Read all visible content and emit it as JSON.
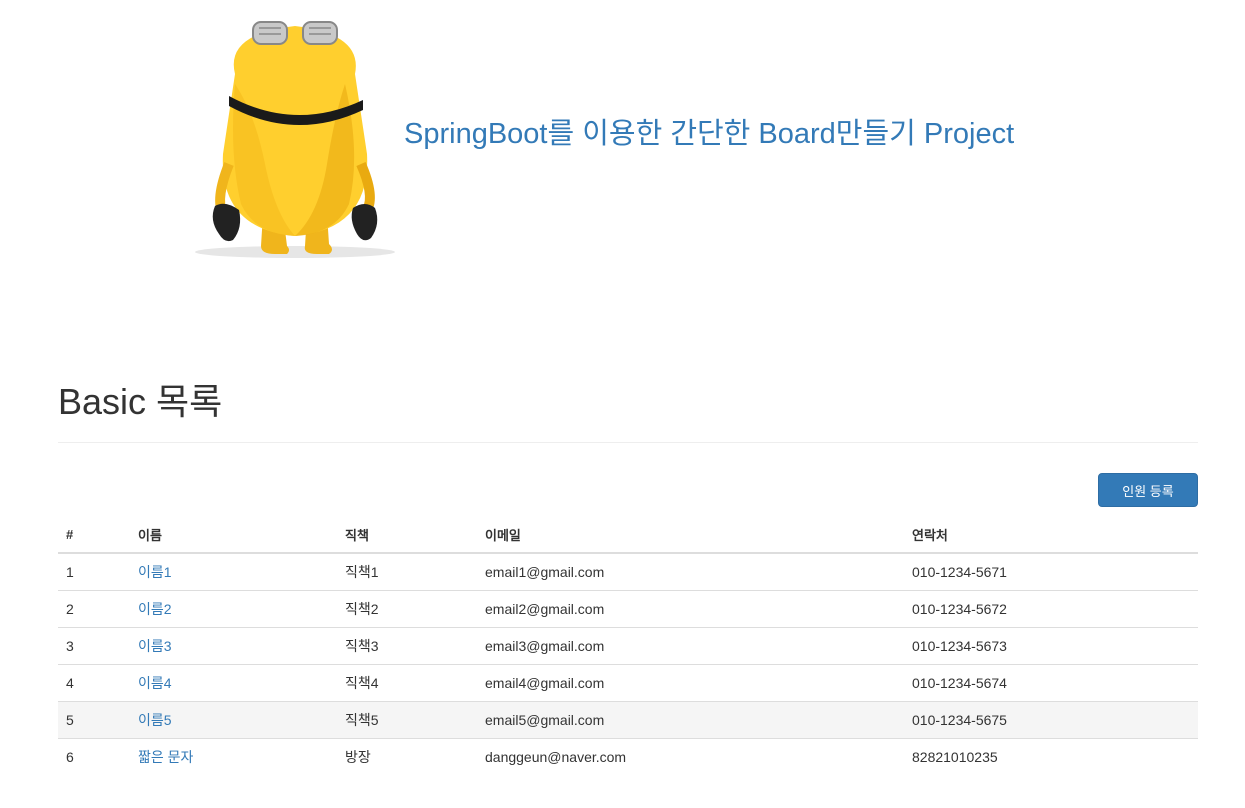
{
  "header": {
    "title": "SpringBoot를 이용한 간단한 Board만들기 Project"
  },
  "page": {
    "title": "Basic 목록",
    "register_button": "인원 등록"
  },
  "table": {
    "columns": [
      "#",
      "이름",
      "직책",
      "이메일",
      "연락처"
    ],
    "rows": [
      {
        "no": "1",
        "name": "이름1",
        "position": "직책1",
        "email": "email1@gmail.com",
        "phone": "010-1234-5671"
      },
      {
        "no": "2",
        "name": "이름2",
        "position": "직책2",
        "email": "email2@gmail.com",
        "phone": "010-1234-5672"
      },
      {
        "no": "3",
        "name": "이름3",
        "position": "직책3",
        "email": "email3@gmail.com",
        "phone": "010-1234-5673"
      },
      {
        "no": "4",
        "name": "이름4",
        "position": "직책4",
        "email": "email4@gmail.com",
        "phone": "010-1234-5674"
      },
      {
        "no": "5",
        "name": "이름5",
        "position": "직책5",
        "email": "email5@gmail.com",
        "phone": "010-1234-5675"
      },
      {
        "no": "6",
        "name": "짧은 문자",
        "position": "방장",
        "email": "danggeun@naver.com",
        "phone": "82821010235"
      }
    ]
  },
  "colors": {
    "link": "#337ab7",
    "button_bg": "#337ab7",
    "row_hover": "#f5f5f5"
  }
}
